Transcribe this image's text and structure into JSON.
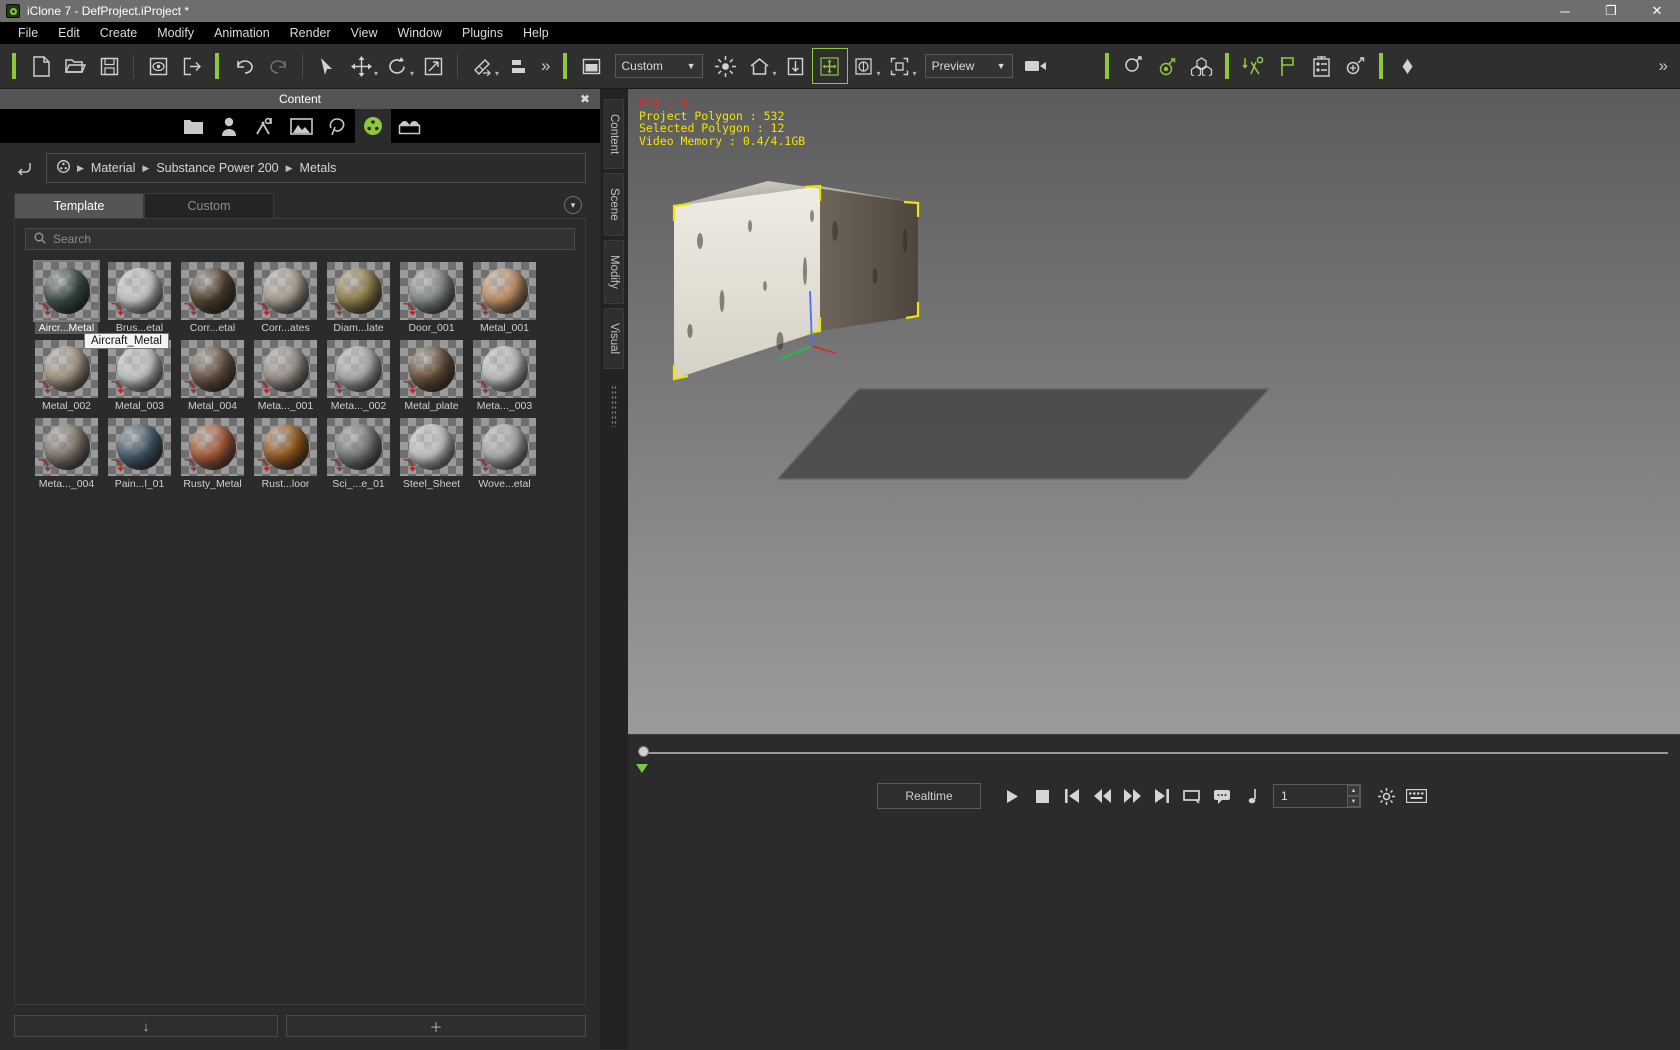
{
  "window": {
    "title": "iClone 7 - DefProject.iProject *",
    "app_icon": "iclone-logo-icon",
    "buttons": {
      "minimize": "─",
      "maximize": "❐",
      "close": "✕"
    }
  },
  "menubar": {
    "items": [
      "File",
      "Edit",
      "Create",
      "Modify",
      "Animation",
      "Render",
      "View",
      "Window",
      "Plugins",
      "Help"
    ]
  },
  "toolbar": {
    "file_tools": [
      "new-document-icon",
      "open-folder-icon",
      "save-disk-icon"
    ],
    "project_tools": [
      "preview-project-icon",
      "export-project-icon"
    ],
    "history_tools": [
      "undo-icon",
      "redo-icon"
    ],
    "transform_tools": [
      "select-arrow-icon",
      "move-icon",
      "rotate-icon",
      "scale-icon"
    ],
    "edit_tools": [
      "attach-icon",
      "align-icon"
    ],
    "overflow_label": "»",
    "layout_icon": "layout-panel-icon",
    "layout_preset": {
      "value": "Custom",
      "arrow": "▼"
    },
    "view_tools": [
      "light-icon",
      "home-view-icon",
      "ground-icon",
      "move-gizmo-icon",
      "orbit-icon",
      "frame-selection-icon"
    ],
    "render_mode": {
      "value": "Preview",
      "arrow": "▼"
    },
    "camera_icon": "video-camera-icon",
    "green_tools": [
      "character-icon",
      "character-motion-icon",
      "props-group-icon"
    ],
    "right_tools": [
      "import-motion-icon",
      "flag-icon",
      "timeline-list-icon",
      "spring-icon",
      "keyframe-icon"
    ],
    "right_overflow": "»"
  },
  "content_panel": {
    "title": "Content",
    "close_icon": "close-circle-icon",
    "categories": [
      {
        "name": "folder-icon",
        "active": false
      },
      {
        "name": "avatar-icon",
        "active": false
      },
      {
        "name": "motion-icon",
        "active": false
      },
      {
        "name": "stage-icon",
        "active": false
      },
      {
        "name": "prop-tree-icon",
        "active": false
      },
      {
        "name": "material-icon",
        "active": true
      },
      {
        "name": "package-icon",
        "active": false
      }
    ],
    "back_icon": "back-arrow-icon",
    "breadcrumb": {
      "root_icon": "material-ball-icon",
      "separator": "▶",
      "path": [
        "Material",
        "Substance Power 200",
        "Metals"
      ]
    },
    "tabs": [
      {
        "label": "Template",
        "active": true
      },
      {
        "label": "Custom",
        "active": false
      }
    ],
    "collapse_icon": "chevron-down-icon",
    "search": {
      "icon": "search-icon",
      "placeholder": "Search",
      "value": ""
    },
    "tooltip": "Aircraft_Metal",
    "items": [
      {
        "label": "Aircr...Metal",
        "color": "#3e4f4a",
        "selected": true
      },
      {
        "label": "Brus...etal",
        "color": "#d8dadd",
        "selected": false
      },
      {
        "label": "Corr...etal",
        "color": "#54432f",
        "selected": false
      },
      {
        "label": "Corr...ates",
        "color": "#b8ad9c",
        "selected": false
      },
      {
        "label": "Diam...late",
        "color": "#9b8a4e",
        "selected": false
      },
      {
        "label": "Door_001",
        "color": "#8f9396",
        "selected": false
      },
      {
        "label": "Metal_001",
        "color": "#d09a6a",
        "selected": false
      },
      {
        "label": "Metal_002",
        "color": "#b2a290",
        "selected": false
      },
      {
        "label": "Metal_003",
        "color": "#d5d7da",
        "selected": false
      },
      {
        "label": "Metal_004",
        "color": "#6e5847",
        "selected": false
      },
      {
        "label": "Meta..._001",
        "color": "#a79e94",
        "selected": false
      },
      {
        "label": "Meta..._002",
        "color": "#b9bcbd",
        "selected": false
      },
      {
        "label": "Metal_plate",
        "color": "#6b543a",
        "selected": false
      },
      {
        "label": "Meta..._003",
        "color": "#cfd2d5",
        "selected": false
      },
      {
        "label": "Meta..._004",
        "color": "#8a7f75",
        "selected": false
      },
      {
        "label": "Pain...l_01",
        "color": "#476070",
        "selected": false
      },
      {
        "label": "Rusty_Metal",
        "color": "#b5613a",
        "selected": false
      },
      {
        "label": "Rust...loor",
        "color": "#a0601f",
        "selected": false
      },
      {
        "label": "Sci_...e_01",
        "color": "#7f8184",
        "selected": false
      },
      {
        "label": "Steel_Sheet",
        "color": "#d3d5d8",
        "selected": false
      },
      {
        "label": "Wove...etal",
        "color": "#b9bcbf",
        "selected": false
      }
    ],
    "footer": {
      "load_icon": "↓",
      "add_icon": "＋"
    }
  },
  "dock_tabs": [
    {
      "label": "Content",
      "active": true
    },
    {
      "label": "Scene",
      "active": false
    },
    {
      "label": "Modify",
      "active": false
    },
    {
      "label": "Visual",
      "active": false
    }
  ],
  "viewport": {
    "stats": {
      "fps": "FPS : 0.",
      "project_polygon": "Project Polygon : 532",
      "selected_polygon": "Selected Polygon : 12",
      "video_memory": "Video Memory : 0.4/4.1GB"
    },
    "selection_color": "#f2e400",
    "object": "selected-cube"
  },
  "timeline": {
    "current_position": 0
  },
  "transport": {
    "mode_label": "Realtime",
    "buttons": [
      "play-icon",
      "stop-icon",
      "jump-start-icon",
      "step-back-icon",
      "step-forward-icon",
      "jump-end-icon",
      "loop-icon",
      "preview-range-icon",
      "audio-note-icon"
    ],
    "frame_value": "1",
    "spinner_up": "▲",
    "spinner_down": "▼",
    "settings_icon": "gear-icon",
    "keyboard_icon": "keyboard-icon"
  }
}
